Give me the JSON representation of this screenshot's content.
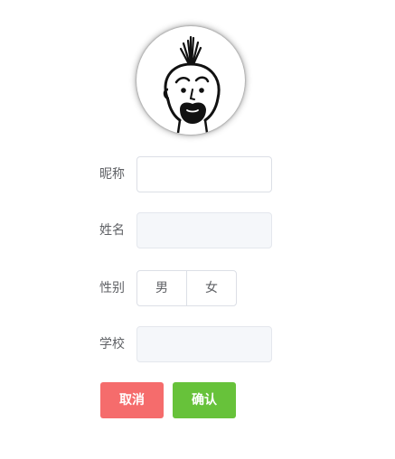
{
  "avatar": {
    "icon": "cartoon-face-avatar"
  },
  "form": {
    "nickname": {
      "label": "昵称",
      "value": ""
    },
    "name": {
      "label": "姓名",
      "value": ""
    },
    "gender": {
      "label": "性别",
      "options": [
        "男",
        "女"
      ]
    },
    "school": {
      "label": "学校",
      "value": ""
    }
  },
  "actions": {
    "cancel_label": "取消",
    "confirm_label": "确认"
  },
  "colors": {
    "cancel": "#f56c6c",
    "confirm": "#67c23a",
    "border": "#dcdfe6",
    "disabled_bg": "#f5f7fa",
    "label": "#606266"
  }
}
